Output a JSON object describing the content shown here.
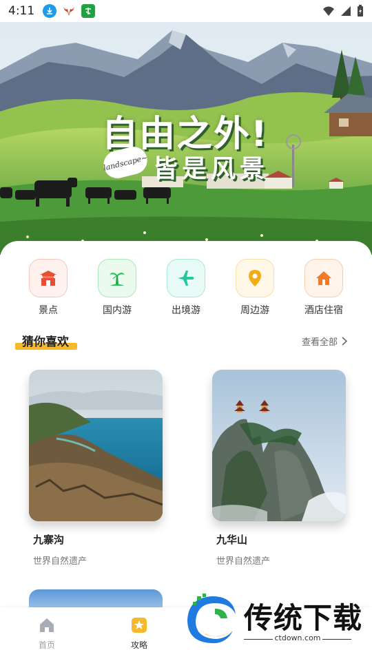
{
  "status_bar": {
    "time": "4:11",
    "apps": [
      {
        "icon": "download-icon",
        "color": "#1e9be9"
      },
      {
        "icon": "bull-logo-icon",
        "color": "#d0452a"
      },
      {
        "icon": "tomato-app-icon",
        "color": "#22a042"
      }
    ],
    "indicators": [
      "wifi-icon",
      "signal-icon",
      "battery-icon"
    ]
  },
  "hero": {
    "title_line1": "自由之外!",
    "title_line2": "皆是风景",
    "badge": "landscape~"
  },
  "categories": [
    {
      "label": "景点",
      "icon": "temple-icon",
      "bg": "#fff1ee",
      "border": "#f7c6bb",
      "color": "#e45035"
    },
    {
      "label": "国内游",
      "icon": "palm-tree-icon",
      "bg": "#eafbee",
      "border": "#a9e8b7",
      "color": "#2cc35c"
    },
    {
      "label": "出境游",
      "icon": "airplane-icon",
      "bg": "#e8fbf6",
      "border": "#a2e9d6",
      "color": "#25c79c"
    },
    {
      "label": "周边游",
      "icon": "location-pin-icon",
      "bg": "#fff8e8",
      "border": "#f7dfa2",
      "color": "#f2ac17"
    },
    {
      "label": "酒店住宿",
      "icon": "house-icon",
      "bg": "#fff3ea",
      "border": "#f7cfae",
      "color": "#f07a27"
    }
  ],
  "recommend": {
    "title": "猜你喜欢",
    "see_all": "查看全部",
    "items": [
      {
        "title": "九寨沟",
        "subtitle": "世界自然遗产"
      },
      {
        "title": "九华山",
        "subtitle": "世界自然遗产"
      }
    ]
  },
  "bottom_nav": [
    {
      "label": "首页",
      "icon": "home-icon",
      "active": false,
      "color": "#9aa0a6"
    },
    {
      "label": "攻略",
      "icon": "star-card-icon",
      "active": true,
      "color": "#f6b92b"
    }
  ],
  "watermark": {
    "text": "传统下载",
    "url": "ctdown.com"
  }
}
